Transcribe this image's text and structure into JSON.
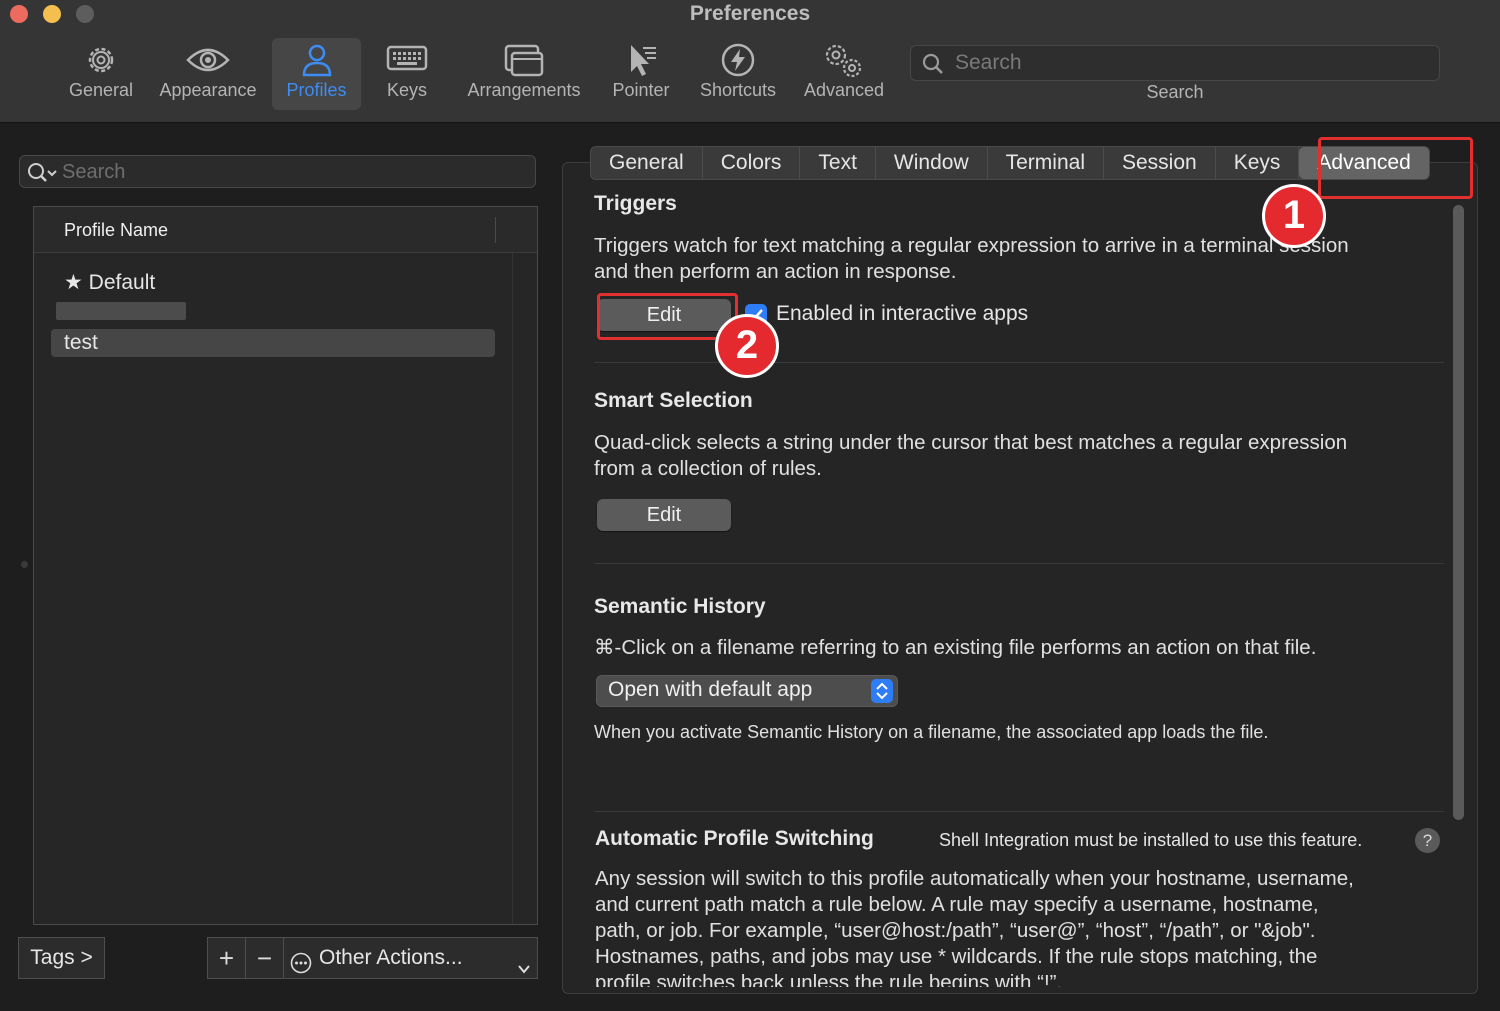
{
  "window": {
    "title": "Preferences"
  },
  "toolbar": {
    "items": [
      {
        "label": "General",
        "icon": "gear-icon"
      },
      {
        "label": "Appearance",
        "icon": "eye-icon"
      },
      {
        "label": "Profiles",
        "icon": "person-icon",
        "selected": true
      },
      {
        "label": "Keys",
        "icon": "keyboard-icon"
      },
      {
        "label": "Arrangements",
        "icon": "windows-icon"
      },
      {
        "label": "Pointer",
        "icon": "cursor-icon"
      },
      {
        "label": "Shortcuts",
        "icon": "lightning-icon"
      },
      {
        "label": "Advanced",
        "icon": "gears-icon"
      }
    ],
    "search": {
      "placeholder": "Search",
      "caption": "Search"
    }
  },
  "profiles": {
    "search_placeholder": "Search",
    "column_header": "Profile Name",
    "rows": [
      {
        "label": "Default",
        "default": true
      },
      {
        "label": "",
        "redacted": true
      },
      {
        "label": "test",
        "selected": true
      }
    ],
    "footer": {
      "tags_label": "Tags >",
      "add_label": "+",
      "remove_label": "−",
      "other_actions_label": "Other Actions..."
    }
  },
  "subtabs": {
    "items": [
      "General",
      "Colors",
      "Text",
      "Window",
      "Terminal",
      "Session",
      "Keys",
      "Advanced"
    ],
    "selected": "Advanced"
  },
  "triggers": {
    "title": "Triggers",
    "description_1": "Triggers watch for text matching a regular expression to arrive in a terminal session",
    "description_2": "and then perform an action in response.",
    "edit_label": "Edit",
    "checkbox_label": "Enabled in interactive apps",
    "checkbox_checked": true
  },
  "smart_selection": {
    "title": "Smart Selection",
    "description_1": "Quad-click selects a string under the cursor that best matches a regular expression",
    "description_2": "from a collection of rules.",
    "edit_label": "Edit"
  },
  "semantic_history": {
    "title": "Semantic History",
    "description": "⌘-Click on a filename referring to an existing file performs an action on that file.",
    "select_value": "Open with default app",
    "note": "When you activate Semantic History on a filename, the associated app loads the file."
  },
  "automatic_profile_switching": {
    "title": "Automatic Profile Switching",
    "note": "Shell Integration must be installed to use this feature.",
    "help_label": "?",
    "description_1": "Any session will switch to this profile automatically when your hostname, username,",
    "description_2": "and current path match a rule below. A rule may specify a username, hostname,",
    "description_3": "path, or job. For example, “user@host:/path”, “user@”, “host”, “/path”, or \"&job\".",
    "description_4": "Hostnames, paths, and jobs may use * wildcards. If the rule stops matching, the",
    "description_5": "profile switches back unless the rule begins with “!”."
  },
  "annotations": {
    "badge_1": "1",
    "badge_2": "2",
    "color": "#e23030"
  },
  "colors": {
    "accent": "#3d8df5",
    "checkbox": "#2f7df6",
    "annotation_red": "#e4292f"
  }
}
